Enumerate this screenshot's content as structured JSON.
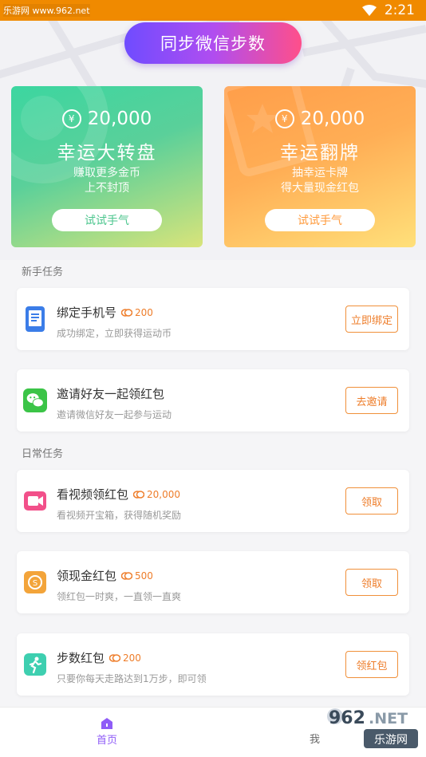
{
  "status_bar": {
    "watermark": "乐游网 www.962.net",
    "time": "2:21"
  },
  "sync_button": {
    "label": "同步微信步数"
  },
  "promos": [
    {
      "amount": "20,000",
      "currency_symbol": "¥",
      "title": "幸运大转盘",
      "desc_line1": "赚取更多金币",
      "desc_line2": "上不封顶",
      "button": "试试手气"
    },
    {
      "amount": "20,000",
      "currency_symbol": "¥",
      "title": "幸运翻牌",
      "desc_line1": "抽幸运卡牌",
      "desc_line2": "得大量现金红包",
      "button": "试试手气"
    }
  ],
  "sections": {
    "newbie": "新手任务",
    "daily": "日常任务"
  },
  "tasks": [
    {
      "icon": "phone-icon",
      "name": "绑定手机号",
      "reward": "200",
      "desc": "成功绑定，立即获得运动币",
      "button": "立即绑定"
    },
    {
      "icon": "wechat-icon",
      "name": "邀请好友一起领红包",
      "reward": "",
      "desc": "邀请微信好友一起参与运动",
      "button": "去邀请"
    },
    {
      "icon": "video-icon",
      "name": "看视频领红包",
      "reward": "20,000",
      "desc": "看视频开宝箱，获得随机奖励",
      "button": "领取"
    },
    {
      "icon": "cash-icon",
      "name": "领现金红包",
      "reward": "500",
      "desc": "领红包一时爽，一直领一直爽",
      "button": "领取"
    },
    {
      "icon": "running-icon",
      "name": "步数红包",
      "reward": "200",
      "desc": "只要你每天走路达到1万步，即可领",
      "button": "领红包"
    }
  ],
  "nav": {
    "home": "首页",
    "mine": "我"
  },
  "watermark_right": {
    "line1": "962.NET",
    "line2": "乐游网"
  },
  "colors": {
    "status_bar": "#f08a00",
    "accent_purple": "#8f5cf7",
    "accent_orange": "#ee7d2a"
  }
}
